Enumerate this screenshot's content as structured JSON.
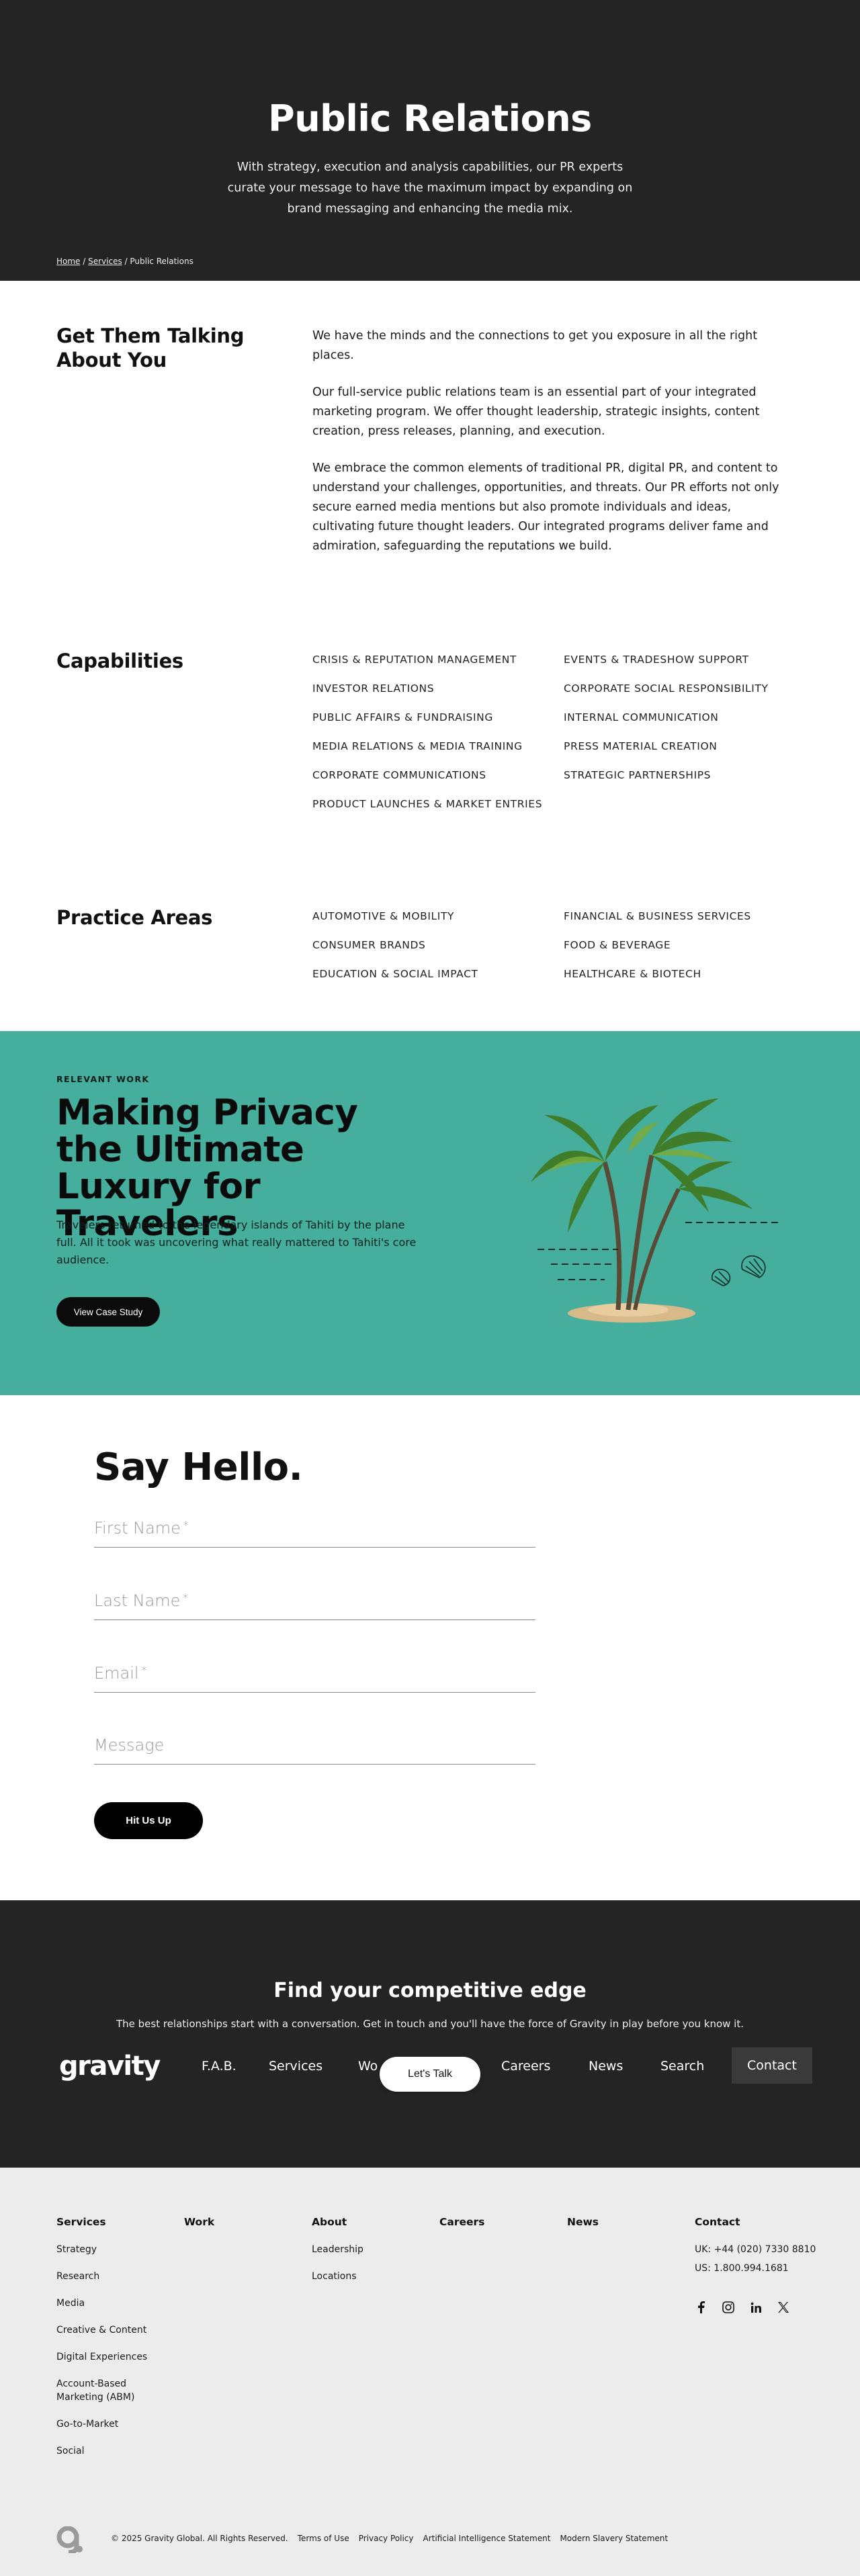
{
  "hero": {
    "title": "Public Relations",
    "subtitle": "With strategy, execution and analysis capabilities, our PR experts curate your message to have the maximum impact by expanding on brand messaging and enhancing the media mix.",
    "breadcrumb": {
      "home": "Home",
      "sep1": " / ",
      "services": "Services",
      "sep2": " / ",
      "current": "Public Relations"
    }
  },
  "intro": {
    "title": "Get Them Talking About You",
    "paragraphs": [
      "We have the minds and the connections to get you exposure in all the right places.",
      "Our full-service public relations team is an essential part of your integrated marketing program. We offer thought leadership, strategic insights, content creation, press releases, planning, and execution.",
      "We embrace the common elements of traditional PR, digital PR, and content to understand your challenges, opportunities, and threats. Our PR efforts not only secure earned media mentions but also promote individuals and ideas, cultivating future thought leaders. Our integrated programs deliver fame and admiration, safeguarding the reputations we build."
    ]
  },
  "capabilities": {
    "title": "Capabilities",
    "col1": [
      "CRISIS & REPUTATION MANAGEMENT",
      "INVESTOR RELATIONS",
      "PUBLIC AFFAIRS & FUNDRAISING",
      "MEDIA RELATIONS & MEDIA TRAINING",
      "CORPORATE COMMUNICATIONS",
      "PRODUCT LAUNCHES & MARKET ENTRIES"
    ],
    "col2": [
      "EVENTS & TRADESHOW SUPPORT",
      "CORPORATE SOCIAL RESPONSIBILITY",
      "INTERNAL COMMUNICATION",
      "PRESS MATERIAL CREATION",
      "STRATEGIC PARTNERSHIPS"
    ]
  },
  "practice": {
    "title": "Practice Areas",
    "col1": [
      "AUTOMOTIVE & MOBILITY",
      "CONSUMER BRANDS",
      "EDUCATION & SOCIAL IMPACT"
    ],
    "col2": [
      "FINANCIAL & BUSINESS SERVICES",
      "FOOD & BEVERAGE",
      "HEALTHCARE & BIOTECH"
    ]
  },
  "case_study": {
    "eyebrow": "RELEVANT WORK",
    "title": "Making Privacy the Ultimate Luxury for Travelers",
    "description": "Travelers returned to the legendary islands of Tahiti by the plane full. All it took was uncovering what really mattered to Tahiti's core audience.",
    "button": "View Case Study",
    "accent": "#45ae9d"
  },
  "contact_form": {
    "title": "Say Hello.",
    "first_name": "First Name",
    "last_name": "Last Name",
    "email": "Email",
    "message": "Message",
    "required_mark": "*",
    "submit": "Hit Us Up"
  },
  "cta": {
    "title": "Find your competitive edge",
    "text": "The best relationships start with a conversation. Get in touch and you'll have the force of Gravity in play before you know it.",
    "logo": "gravity",
    "nav": [
      "F.A.B.",
      "Services",
      "Wo",
      "Careers",
      "News",
      "Search"
    ],
    "contact": "Contact",
    "talk_button": "Let's Talk"
  },
  "footer": {
    "columns": [
      {
        "heading": "Services",
        "items": [
          "Strategy",
          "Research",
          "Media",
          "Creative & Content",
          "Digital Experiences",
          "Account-Based Marketing (ABM)",
          "Go-to-Market",
          "Social"
        ]
      },
      {
        "heading": "Work",
        "items": []
      },
      {
        "heading": "About",
        "items": [
          "Leadership",
          "Locations"
        ]
      },
      {
        "heading": "Careers",
        "items": []
      },
      {
        "heading": "News",
        "items": []
      },
      {
        "heading": "Contact",
        "items": [
          "UK: +44 (020) 7330 8810",
          "US: 1.800.994.1681"
        ]
      }
    ],
    "social": [
      "facebook-icon",
      "instagram-icon",
      "linkedin-icon",
      "x-icon"
    ],
    "copyright": "© 2025 Gravity Global. All Rights Reserved.",
    "links": [
      "Terms of Use",
      "Privacy Policy",
      "Artificial Intelligence Statement",
      "Modern Slavery Statement"
    ]
  }
}
